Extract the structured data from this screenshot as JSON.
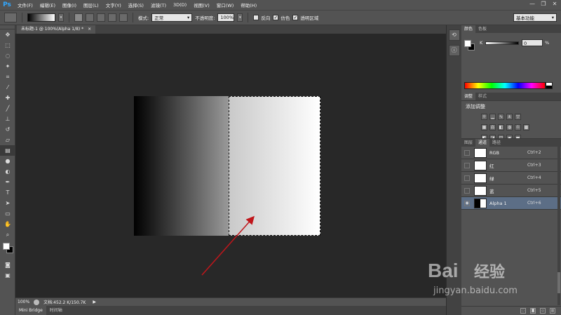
{
  "app": {
    "logo": "Ps"
  },
  "menu": [
    "文件(F)",
    "编辑(E)",
    "图像(I)",
    "图层(L)",
    "文字(Y)",
    "选择(S)",
    "滤镜(T)",
    "3D(D)",
    "视图(V)",
    "窗口(W)",
    "帮助(H)"
  ],
  "window_controls": {
    "minimize": "—",
    "restore": "❐",
    "close": "✕"
  },
  "options": {
    "mode_label": "模式:",
    "mode_value": "正常",
    "opacity_label": "不透明度:",
    "opacity_value": "100%",
    "reverse_label": "反向",
    "dither_label": "仿色",
    "transparency_label": "透明区域",
    "dither_checked": "✓",
    "transparency_checked": "✓",
    "workspace": "基本功能",
    "dropdown_glyph": "▾"
  },
  "document_tab": {
    "title": "未标题-1 @ 100%(Alpha 1/8) *",
    "close": "×"
  },
  "status": {
    "zoom": "100%",
    "doc_size": "文档:452.2 K/150.7K",
    "arrow": "▶"
  },
  "bottom_tabs": [
    "Mini Bridge",
    "时间轴"
  ],
  "panels": {
    "color_tabs": [
      "颜色",
      "色板"
    ],
    "color": {
      "channel": "K",
      "value": "0",
      "unit": "%"
    },
    "adjust_tabs": [
      "调整",
      "样式"
    ],
    "adjust_title": "添加调整",
    "channel_tabs": [
      "图层",
      "通道",
      "路径"
    ],
    "channels": [
      {
        "name": "RGB",
        "shortcut": "Ctrl+2"
      },
      {
        "name": "红",
        "shortcut": "Ctrl+3"
      },
      {
        "name": "绿",
        "shortcut": "Ctrl+4"
      },
      {
        "name": "蓝",
        "shortcut": "Ctrl+5"
      },
      {
        "name": "Alpha 1",
        "shortcut": "Ctrl+6"
      }
    ],
    "eye_glyph": "◉"
  },
  "watermark": {
    "brand_left": "Bai",
    "brand_right": "经验",
    "url": "jingyan.baidu.com"
  },
  "colors": {
    "accent_arrow": "#c0161b",
    "selected_row": "#5c6e86"
  }
}
